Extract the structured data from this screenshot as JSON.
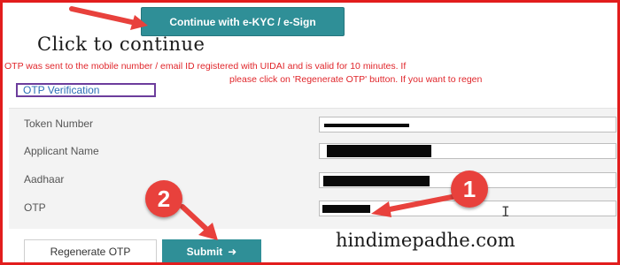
{
  "header": {
    "kyc_button_label": "Continue with e-KYC / e-Sign",
    "annotation_text": "Click to continue"
  },
  "message": {
    "line1": "OTP was sent to the mobile number / email ID registered with UIDAI and is valid for 10 minutes. If",
    "line2": "please click on 'Regenerate OTP' button. If you want to regen"
  },
  "section": {
    "title": "OTP Verification"
  },
  "form": {
    "fields": [
      {
        "label": "Token Number"
      },
      {
        "label": "Applicant Name"
      },
      {
        "label": "Aadhaar"
      },
      {
        "label": "OTP"
      }
    ]
  },
  "actions": {
    "regenerate_label": "Regenerate OTP",
    "submit_label": "Submit",
    "submit_icon": "arrow-right-icon"
  },
  "annotations": {
    "badge_1": "1",
    "badge_2": "2",
    "watermark": "hindimepadhe.com",
    "accent_color": "#e8413c",
    "button_color": "#2f8f97"
  }
}
